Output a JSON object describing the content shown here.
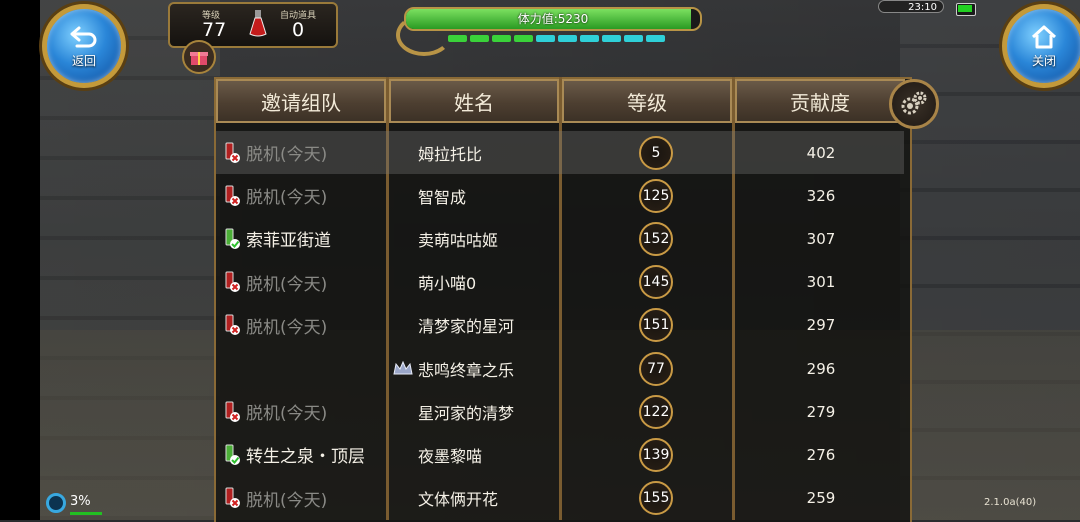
{
  "hud": {
    "back_label": "返回",
    "close_label": "关闭",
    "level_label": "等级",
    "level_value": "77",
    "auto_item_label": "自动道具",
    "auto_item_value": "0",
    "stamina_text": "体力值:5230",
    "stamina_fraction": 0.97,
    "clock": "23:10",
    "progress_percent": "3%",
    "version": "2.1.0a(40)"
  },
  "table": {
    "headers": {
      "invite": "邀请组队",
      "name": "姓名",
      "level": "等级",
      "contribution": "贡献度"
    },
    "rows": [
      {
        "status": "offline",
        "location": "脱机(今天)",
        "name": "姆拉托比",
        "level": "5",
        "contribution": "402",
        "highlight": true,
        "badge": ""
      },
      {
        "status": "offline",
        "location": "脱机(今天)",
        "name": "智智成",
        "level": "125",
        "contribution": "326",
        "highlight": false,
        "badge": ""
      },
      {
        "status": "online",
        "location": "索菲亚街道",
        "name": "卖萌咕咕姬",
        "level": "152",
        "contribution": "307",
        "highlight": false,
        "badge": ""
      },
      {
        "status": "offline",
        "location": "脱机(今天)",
        "name": "萌小喵0",
        "level": "145",
        "contribution": "301",
        "highlight": false,
        "badge": ""
      },
      {
        "status": "offline",
        "location": "脱机(今天)",
        "name": "清梦家的星河",
        "level": "151",
        "contribution": "297",
        "highlight": false,
        "badge": ""
      },
      {
        "status": "none",
        "location": "",
        "name": "悲鸣终章之乐",
        "level": "77",
        "contribution": "296",
        "highlight": false,
        "badge": "crown-icon"
      },
      {
        "status": "offline",
        "location": "脱机(今天)",
        "name": "星河家的清梦",
        "level": "122",
        "contribution": "279",
        "highlight": false,
        "badge": ""
      },
      {
        "status": "online",
        "location": "转生之泉・顶层",
        "name": "夜墨黎喵",
        "level": "139",
        "contribution": "276",
        "highlight": false,
        "badge": ""
      },
      {
        "status": "offline",
        "location": "脱机(今天)",
        "name": "文体俩开花",
        "level": "155",
        "contribution": "259",
        "highlight": false,
        "badge": ""
      }
    ]
  },
  "colors": {
    "panel_border": "#8a6a36",
    "offline_text": "#8a8a86",
    "online_icon": "#2ec02e",
    "offline_icon": "#d02020"
  }
}
